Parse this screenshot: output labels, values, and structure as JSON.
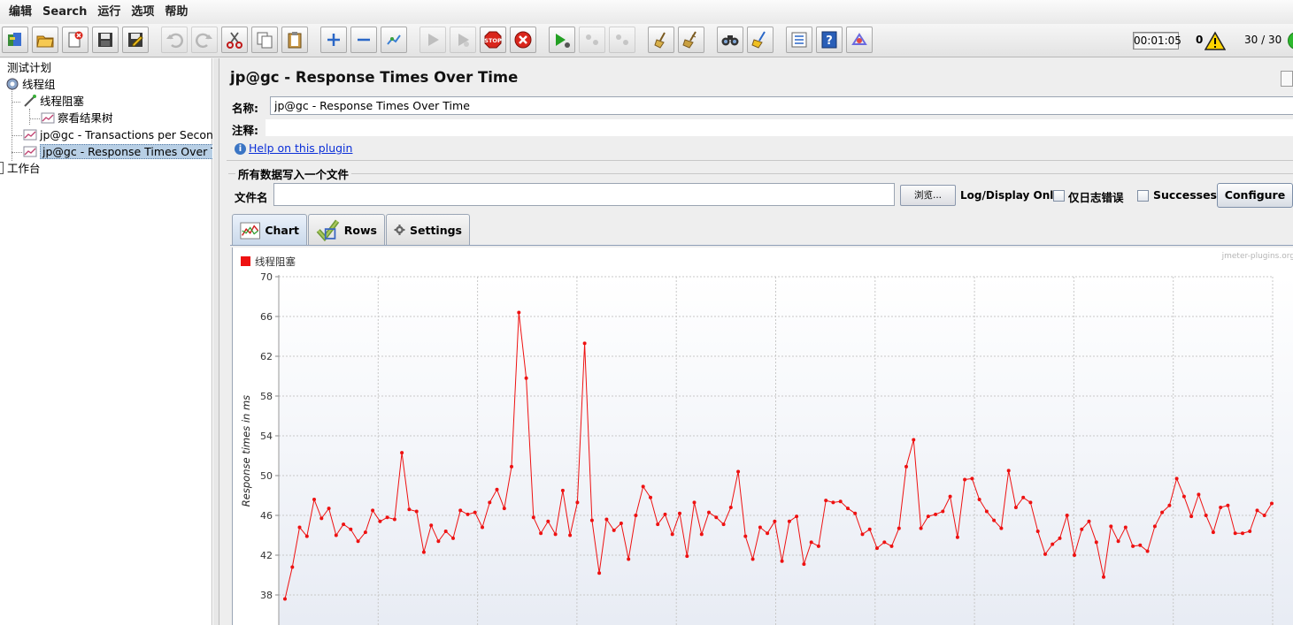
{
  "menu": [
    "编辑",
    "Search",
    "运行",
    "选项",
    "帮助"
  ],
  "toolbar": {
    "timer": "00:01:05",
    "error_count": "0",
    "threads": "30 / 30"
  },
  "tree": {
    "root": "测试计划",
    "thread_group": "线程组",
    "timer_item": "线程阻塞",
    "listener_tree": "察看结果树",
    "tps": "jp@gc - Transactions per Second",
    "rt": "jp@gc - Response Times Over Time",
    "workbench": "工作台"
  },
  "panel": {
    "title": "jp@gc - Response Times Over Time",
    "name_label": "名称:",
    "name_value": "jp@gc - Response Times Over Time",
    "comment_label": "注释:",
    "comment_value": "",
    "help_link": "Help on this plugin",
    "file_legend": "所有数据写入一个文件",
    "file_label": "文件名",
    "file_value": "",
    "browse_label": "浏览...",
    "log_display": "Log/Display Only:",
    "errors_label": "仅日志错误",
    "successes_label": "Successes",
    "configure_label": "Configure"
  },
  "tabs": [
    {
      "label": "Chart",
      "icon": "chart-icon",
      "active": true
    },
    {
      "label": "Rows",
      "icon": "checkmark-icon",
      "active": false
    },
    {
      "label": "Settings",
      "icon": "gear-icon",
      "active": false
    }
  ],
  "colors": {
    "series": "#ee1111",
    "grid": "#c8c8c8",
    "chart_bg_bottom": "#e8ecf4"
  },
  "chart_data": {
    "type": "line",
    "watermark": "jmeter-plugins.org",
    "ylabel": "Response times in ms",
    "xlabel": "",
    "ylim": [
      35,
      70
    ],
    "yticks": [
      38,
      42,
      46,
      50,
      54,
      58,
      62,
      66,
      70
    ],
    "grid": true,
    "legend": "top-left",
    "series": [
      {
        "name": "线程阻塞",
        "color": "#ee1111",
        "values": [
          37.6,
          40.8,
          44.8,
          43.9,
          47.6,
          45.7,
          46.7,
          44.0,
          45.1,
          44.6,
          43.4,
          44.3,
          46.5,
          45.4,
          45.8,
          45.6,
          52.3,
          46.6,
          46.4,
          42.3,
          45.0,
          43.4,
          44.4,
          43.7,
          46.5,
          46.1,
          46.3,
          44.8,
          47.3,
          48.6,
          46.7,
          50.9,
          66.4,
          59.8,
          45.8,
          44.2,
          45.4,
          44.1,
          48.5,
          44.0,
          47.3,
          63.3,
          45.5,
          40.2,
          45.6,
          44.5,
          45.2,
          41.6,
          46.0,
          48.9,
          47.8,
          45.1,
          46.1,
          44.1,
          46.2,
          41.9,
          47.3,
          44.1,
          46.3,
          45.8,
          45.1,
          46.8,
          50.4,
          43.9,
          41.6,
          44.8,
          44.2,
          45.4,
          41.4,
          45.4,
          45.9,
          41.1,
          43.3,
          42.9,
          47.5,
          47.3,
          47.4,
          46.7,
          46.2,
          44.1,
          44.6,
          42.7,
          43.3,
          42.9,
          44.7,
          50.9,
          53.6,
          44.7,
          45.9,
          46.1,
          46.4,
          47.9,
          43.8,
          49.6,
          49.7,
          47.6,
          46.4,
          45.5,
          44.7,
          50.5,
          46.8,
          47.8,
          47.3,
          44.4,
          42.1,
          43.1,
          43.7,
          46.0,
          42.0,
          44.6,
          45.4,
          43.3,
          39.8,
          44.9,
          43.4,
          44.8,
          42.9,
          43.0,
          42.4,
          44.9,
          46.3,
          47.0,
          49.7,
          47.9,
          45.9,
          48.1,
          46.0,
          44.3,
          46.8,
          47.0,
          44.2,
          44.2,
          44.4,
          46.5,
          46.0,
          47.2
        ]
      }
    ]
  }
}
